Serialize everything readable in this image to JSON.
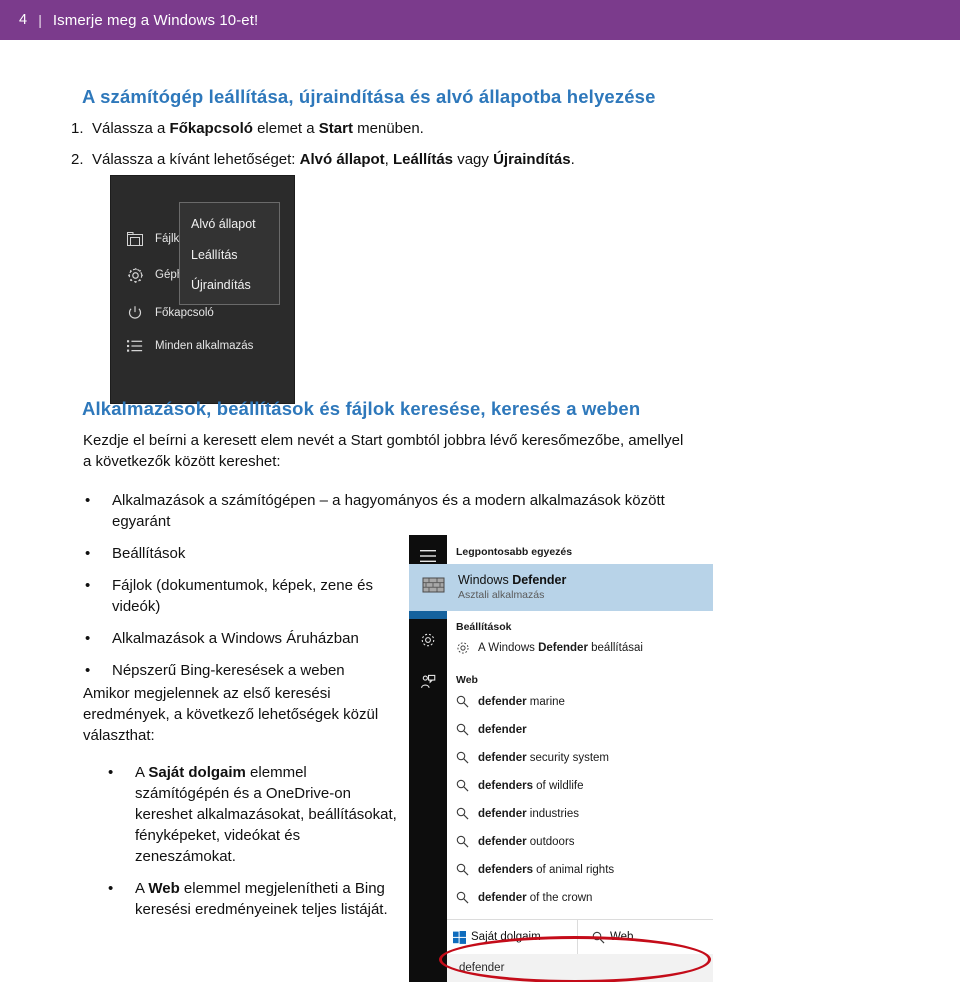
{
  "header": {
    "page_number": "4",
    "separator": "|",
    "title": "Ismerje meg a Windows 10-et!",
    "bar_color": "#7B3B8C"
  },
  "section1": {
    "heading": "A számítógép leállítása, újraindítása és alvó állapotba helyezése",
    "heading_color": "#2E78BB",
    "steps": [
      {
        "marker": "1.",
        "text_parts": [
          "Válassza a ",
          "Főkapcsoló",
          " elemet a ",
          "Start",
          " menüben."
        ]
      },
      {
        "marker": "2.",
        "text_parts": [
          "Válassza a kívánt lehetőséget: ",
          "Alvó állapot",
          ", ",
          "Leállítás",
          " vagy ",
          "Újraindítás",
          "."
        ]
      }
    ]
  },
  "start_menu_image": {
    "background": "#2B2B2B",
    "items": [
      {
        "icon": "folder-icon",
        "label": "Fájlke"
      },
      {
        "icon": "gear-icon",
        "label": "Géph"
      },
      {
        "icon": "power-icon",
        "label": "Főkapcsoló"
      },
      {
        "icon": "all-apps-list-icon",
        "label": "Minden alkalmazás"
      }
    ],
    "popup": {
      "background": "#333333",
      "items": [
        "Alvó állapot",
        "Leállítás",
        "Újraindítás"
      ]
    }
  },
  "section2": {
    "heading": "Alkalmazások, beállítások és fájlok keresése, keresés a weben",
    "intro_line1": "Kezdje el beírni a keresett elem nevét a Start gombtól jobbra lévő keresőmezőbe, amellyel",
    "intro_line2": "a következők között kereshet:",
    "bullets": [
      "Alkalmazások a számítógépen – a hagyományos és a modern alkalmazások között egyaránt",
      "Beállítások",
      "Fájlok (dokumentumok, képek, zene és videók)",
      "Alkalmazások a Windows Áruházban",
      "Népszerű Bing-keresések a weben"
    ],
    "paragraph": "Amikor megjelennek az első keresési eredmények, a következő lehetőségek közül választhat:",
    "bullets2": [
      {
        "parts": [
          "A ",
          "Saját dolgaim",
          " elemmel számítógépén és a OneDrive-on kereshet alkalmazásokat, beállításokat, fényképeket, videókat és zeneszámokat."
        ]
      },
      {
        "parts": [
          "A ",
          "Web",
          " elemmel megjelenítheti a Bing keresési eredményeinek teljes listáját."
        ]
      }
    ]
  },
  "search_image": {
    "rail": [
      {
        "icon": "hamburger-menu-icon",
        "active": false
      },
      {
        "icon": "home-icon",
        "active": true
      },
      {
        "icon": "gear-icon",
        "active": false
      },
      {
        "icon": "feedback-person-icon",
        "active": false
      }
    ],
    "rail_active_color": "#15629E",
    "best_match_label": "Legpontosabb egyezés",
    "best_match": {
      "icon": "firewall-brick-icon",
      "title_normal": "Windows ",
      "title_bold": "Defender",
      "subtitle": "Asztali alkalmazás",
      "highlight_color": "#B8D3E8"
    },
    "settings_label": "Beállítások",
    "settings_result": {
      "icon": "gear-icon",
      "prefix": "A Windows ",
      "bold": "Defender",
      "suffix": " beállításai"
    },
    "web_label": "Web",
    "web_results": [
      {
        "icon": "search-icon",
        "bold": "defender",
        "rest": " marine"
      },
      {
        "icon": "search-icon",
        "bold": "defender",
        "rest": ""
      },
      {
        "icon": "search-icon",
        "bold": "defender",
        "rest": " security system"
      },
      {
        "icon": "search-icon",
        "bold": "defenders",
        "rest": " of wildlife"
      },
      {
        "icon": "search-icon",
        "bold": "defender",
        "rest": " industries"
      },
      {
        "icon": "search-icon",
        "bold": "defender",
        "rest": " outdoors"
      },
      {
        "icon": "search-icon",
        "bold": "defenders",
        "rest": " of animal rights"
      },
      {
        "icon": "search-icon",
        "bold": "defender",
        "rest": " of the crown"
      }
    ],
    "footer": {
      "my_stuff_icon": "windows-logo-icon",
      "my_stuff_label": "Saját dolgaim",
      "web_icon": "search-icon",
      "web_label": "Web"
    },
    "search_box_value": "defender",
    "annotation_color": "#C40C19"
  }
}
